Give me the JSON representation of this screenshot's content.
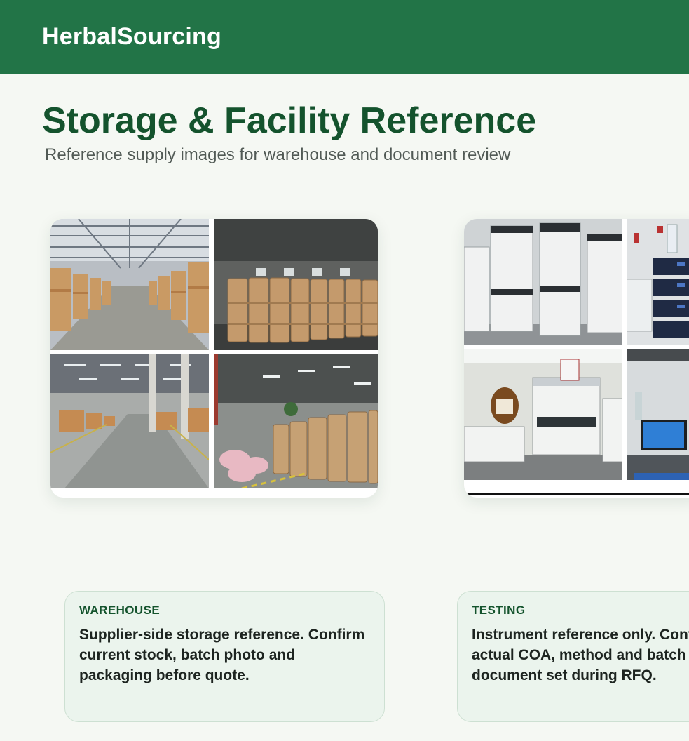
{
  "header": {
    "brand": "HerbalSourcing"
  },
  "page": {
    "title": "Storage & Facility Reference",
    "subtitle": "Reference supply images for warehouse and document review"
  },
  "cards": [
    {
      "images": [
        "warehouse-aisle-photo",
        "drum-stack-photo",
        "pallet-warehouse-photo",
        "drum-and-bag-storage-photo"
      ]
    },
    {
      "images": [
        "hplc-instruments-photo",
        "lab-instruments-photo",
        "lab-bench-photo",
        "lab-computer-photo"
      ]
    }
  ],
  "notes": [
    {
      "tag": "WAREHOUSE",
      "text": "Supplier-side storage reference. Confirm current stock, batch photo and packaging before quote."
    },
    {
      "tag": "TESTING",
      "text": "Instrument reference only. Confirm\nactual COA, method and batch\ndocument set during RFQ."
    }
  ],
  "colors": {
    "header": "#227447",
    "title": "#14532d",
    "background": "#f5f8f3",
    "note_background": "#ebf4ed"
  }
}
